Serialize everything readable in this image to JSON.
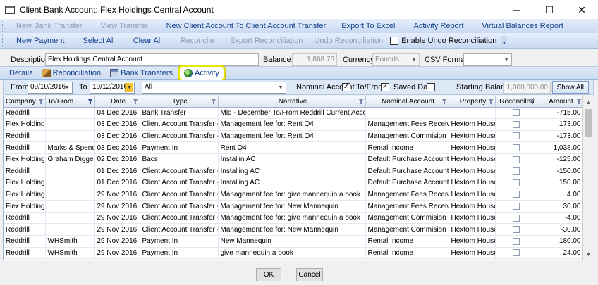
{
  "window": {
    "title": "Client Bank Account: Flex Holdings Central Account",
    "minimize_glyph": "─",
    "maximize_glyph": "☐",
    "close_glyph": "✕"
  },
  "toolbar1": {
    "items": [
      {
        "label": "New Bank Transfer",
        "enabled": false
      },
      {
        "label": "View Transfer",
        "enabled": false
      },
      {
        "label": "New Client Account To Client Account Transfer",
        "enabled": true
      },
      {
        "label": "Export To Excel",
        "enabled": true
      },
      {
        "label": "Activity Report",
        "enabled": true
      },
      {
        "label": "Virtual Balances Report",
        "enabled": true
      }
    ]
  },
  "toolbar2": {
    "items": [
      {
        "label": "New Payment",
        "enabled": true
      },
      {
        "label": "Select All",
        "enabled": true
      },
      {
        "label": "Clear All",
        "enabled": true
      },
      {
        "label": "Reconcile",
        "enabled": false
      },
      {
        "label": "Export Reconciliation",
        "enabled": false
      },
      {
        "label": "Undo Reconciliation",
        "enabled": false
      }
    ],
    "enable_undo_label": "Enable Undo Reconciliation",
    "enable_undo_checked": false
  },
  "fields": {
    "description_label": "Description:",
    "description_value": "Flex Holdings Central Account",
    "balance_label": "Balance:",
    "balance_value": "1,868.76",
    "currency_label": "Currency:",
    "currency_value": "Pounds",
    "csv_label": "CSV Format:",
    "csv_value": ""
  },
  "tabs": {
    "details": "Details",
    "reconciliation": "Reconciliation",
    "bank_transfers": "Bank Transfers",
    "activity": "Activity",
    "active": "activity"
  },
  "filter": {
    "from_label": "From",
    "from_value": "09/10/2016",
    "to_label": "To",
    "to_value": "10/12/2016",
    "type_value": "All",
    "nominal_label": "Nominal Account",
    "nominal_checked": true,
    "tofrom_label": "To/From",
    "tofrom_checked": true,
    "saved_date_label": "Saved Date",
    "saved_date_checked": false,
    "starting_balance_label": "Starting Balance:",
    "starting_balance_value": "1,000,000.00",
    "show_all_label": "Show All"
  },
  "grid": {
    "columns": [
      "Company",
      "To/From",
      "Date",
      "Type",
      "Narrative",
      "Nominal Account",
      "Property",
      "Reconciled",
      "Amount"
    ],
    "rows": [
      [
        "Reddrill",
        "",
        "04 Dec 2016",
        "Bank Transfer",
        "Mid - December To/From  Reddrill Current Account",
        "",
        "",
        "",
        "-715.00"
      ],
      [
        "Flex Holding",
        "",
        "03 Dec 2016",
        "Client Account Transfer - In",
        "Management fee for: Rent Q4",
        "Management Fees Received",
        "Hextom House",
        "",
        "173.00"
      ],
      [
        "Reddrill",
        "",
        "03 Dec 2016",
        "Client Account Transfer - O",
        "Management fee for: Rent Q4",
        "Management Commision Pai",
        "Hextom House",
        "",
        "-173.00"
      ],
      [
        "Reddrill",
        "Marks & Spenc",
        "03 Dec 2016",
        "Payment In",
        "Rent Q4",
        "Rental Income",
        "Hextom House",
        "",
        "1,038.00"
      ],
      [
        "Flex Holding",
        "Graham Digger",
        "02 Dec 2016",
        "Bacs",
        "Installin AC",
        "Default Purchase Account",
        "Hextom House",
        "",
        "-125.00"
      ],
      [
        "Reddrill",
        "",
        "01 Dec 2016",
        "Client Account Transfer - O",
        "Installing AC",
        "Default Purchase Account",
        "Hextom House",
        "",
        "-150.00"
      ],
      [
        "Flex Holding",
        "",
        "01 Dec 2016",
        "Client Account Transfer - In",
        "Installing AC",
        "Default Purchase Account",
        "Hextom House",
        "",
        "150.00"
      ],
      [
        "Flex Holding",
        "",
        "29 Nov 2016",
        "Client Account Transfer - In",
        "Management fee for: give mannequin a book",
        "Management Fees Received",
        "Hextom House",
        "",
        "4.00"
      ],
      [
        "Flex Holding",
        "",
        "29 Nov 2016",
        "Client Account Transfer - In",
        "Management fee for: New Mannequin",
        "Management Fees Received",
        "Hextom House",
        "",
        "30.00"
      ],
      [
        "Reddrill",
        "",
        "29 Nov 2016",
        "Client Account Transfer - O",
        "Management fee for: give mannequin a book",
        "Management Commision Pai",
        "Hextom House",
        "",
        "-4.00"
      ],
      [
        "Reddrill",
        "",
        "29 Nov 2016",
        "Client Account Transfer - O",
        "Management fee for: New Mannequin",
        "Management Commision Pai",
        "Hextom House",
        "",
        "-30.00"
      ],
      [
        "Reddrill",
        "WHSmith",
        "29 Nov 2016",
        "Payment In",
        "New Mannequin",
        "Rental Income",
        "Hextom House",
        "",
        "180.00"
      ],
      [
        "Reddrill",
        "WHSmith",
        "29 Nov 2016",
        "Payment In",
        "give mannequin a book",
        "Rental Income",
        "Hextom House",
        "",
        "24.00"
      ]
    ]
  },
  "buttons": {
    "ok": "OK",
    "cancel": "Cancel"
  }
}
